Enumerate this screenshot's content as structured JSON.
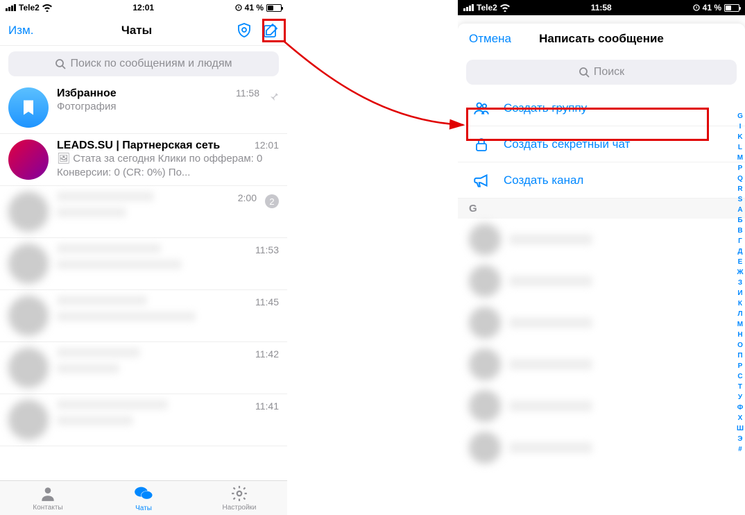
{
  "left": {
    "status": {
      "carrier": "Tele2",
      "time": "12:01",
      "battery": "41 %"
    },
    "nav": {
      "edit": "Изм.",
      "title": "Чаты"
    },
    "search_placeholder": "Поиск по сообщениям и людям",
    "chats": [
      {
        "name": "Избранное",
        "sub": "Фотография",
        "time": "11:58",
        "pinned": true,
        "avatar": "fav"
      },
      {
        "name": "LEADS.SU | Партнерская сеть",
        "sub": "🖼 Стата за сегодня Клики по офферам: 0 Конверсии: 0 (CR: 0%) По...",
        "time": "12:01",
        "avatar": "leads"
      },
      {
        "blurred": true,
        "time": "2:00",
        "badge": "2"
      },
      {
        "blurred": true,
        "time": "11:53"
      },
      {
        "blurred": true,
        "time": "11:45"
      },
      {
        "blurred": true,
        "time": "11:42"
      },
      {
        "blurred": true,
        "time": "11:41"
      }
    ],
    "tabs": {
      "contacts": "Контакты",
      "chats": "Чаты",
      "settings": "Настройки"
    }
  },
  "right": {
    "status": {
      "carrier": "Tele2",
      "time": "11:58",
      "battery": "41 %"
    },
    "nav": {
      "cancel": "Отмена",
      "title": "Написать сообщение"
    },
    "search_placeholder": "Поиск",
    "actions": {
      "group": "Создать группу",
      "secret": "Создать секретный чат",
      "channel": "Создать канал"
    },
    "section": "G",
    "index": [
      "G",
      "I",
      "K",
      "L",
      "M",
      "P",
      "Q",
      "R",
      "S",
      "А",
      "Б",
      "В",
      "Г",
      "Д",
      "Е",
      "Ж",
      "З",
      "И",
      "К",
      "Л",
      "М",
      "Н",
      "О",
      "П",
      "Р",
      "С",
      "Т",
      "У",
      "Ф",
      "Х",
      "Ш",
      "Э",
      "#"
    ]
  }
}
